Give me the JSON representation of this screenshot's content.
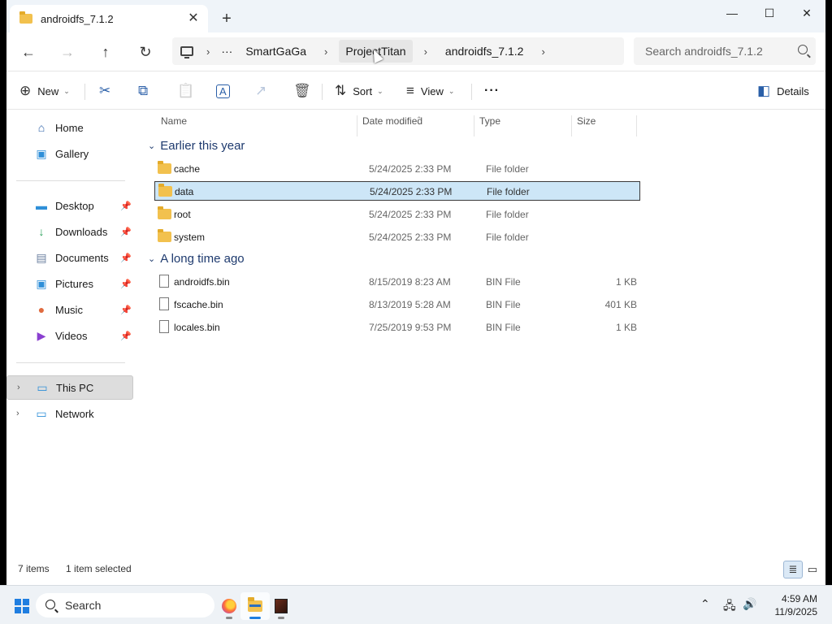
{
  "window": {
    "tab_title": "androidfs_7.1.2",
    "tab_close_glyph": "✕",
    "new_tab_glyph": "+",
    "minimize_glyph": "—",
    "maximize_glyph": "☐",
    "close_glyph": "✕"
  },
  "address": {
    "ellipsis": "···",
    "sep": "›",
    "crumbs": [
      "SmartGaGa",
      "ProjectTitan",
      "androidfs_7.1.2"
    ],
    "search_placeholder": "Search androidfs_7.1.2"
  },
  "nav": {
    "back": "←",
    "forward": "→",
    "up": "↑",
    "refresh": "↻"
  },
  "toolbar": {
    "new_label": "New",
    "sort_label": "Sort",
    "view_label": "View",
    "more_glyph": "···",
    "details_label": "Details",
    "caret": "⌄",
    "icons": {
      "new": "⊕",
      "cut": "✂",
      "copy": "⧉",
      "paste": "📋",
      "rename": "A",
      "share": "↗",
      "delete": "🗑",
      "sort": "⇅",
      "view": "≡",
      "details": "◧"
    }
  },
  "sidebar": {
    "home": "Home",
    "gallery": "Gallery",
    "quick": [
      {
        "label": "Desktop",
        "icon": "desktop-icon",
        "glyph": "▬",
        "color": "#2f8fd8"
      },
      {
        "label": "Downloads",
        "icon": "download-icon",
        "glyph": "↓",
        "color": "#2aa05a"
      },
      {
        "label": "Documents",
        "icon": "documents-icon",
        "glyph": "▤",
        "color": "#6a7fa0"
      },
      {
        "label": "Pictures",
        "icon": "pictures-icon",
        "glyph": "▣",
        "color": "#2f8fd8"
      },
      {
        "label": "Music",
        "icon": "music-icon",
        "glyph": "●",
        "color": "#e06b3f"
      },
      {
        "label": "Videos",
        "icon": "videos-icon",
        "glyph": "▶",
        "color": "#8a3fd0"
      }
    ],
    "pin_glyph": "📌",
    "this_pc": "This PC",
    "network": "Network",
    "expander": "›"
  },
  "columns": {
    "name": "Name",
    "date": "Date modified",
    "type": "Type",
    "size": "Size",
    "sort_caret": "⌃"
  },
  "groups": [
    {
      "title": "Earlier this year",
      "items": [
        {
          "name": "cache",
          "date": "5/24/2025 2:33 PM",
          "type": "File folder",
          "size": ""
        },
        {
          "name": "data",
          "date": "5/24/2025 2:33 PM",
          "type": "File folder",
          "size": ""
        },
        {
          "name": "root",
          "date": "5/24/2025 2:33 PM",
          "type": "File folder",
          "size": ""
        },
        {
          "name": "system",
          "date": "5/24/2025 2:33 PM",
          "type": "File folder",
          "size": ""
        }
      ]
    },
    {
      "title": "A long time ago",
      "items": [
        {
          "name": "androidfs.bin",
          "date": "8/15/2019 8:23 AM",
          "type": "BIN File",
          "size": "1 KB"
        },
        {
          "name": "fscache.bin",
          "date": "8/13/2019 5:28 AM",
          "type": "BIN File",
          "size": "401 KB"
        },
        {
          "name": "locales.bin",
          "date": "7/25/2019 9:53 PM",
          "type": "BIN File",
          "size": "1 KB"
        }
      ]
    }
  ],
  "group_chevron": "⌄",
  "status": {
    "count": "7 items",
    "selected": "1 item selected"
  },
  "taskbar": {
    "search_label": "Search",
    "tray_up": "⌃",
    "tray_network": "🖧",
    "tray_volume": "🔊",
    "time": "4:59 AM",
    "date": "11/9/2025"
  }
}
